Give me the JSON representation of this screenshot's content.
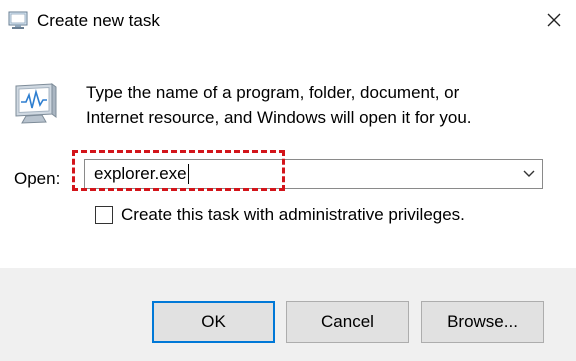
{
  "window": {
    "title": "Create new task",
    "icons": {
      "app": "run-app-icon",
      "close": "close-icon"
    }
  },
  "body": {
    "description_line1": "Type the name of a program, folder, document, or",
    "description_line2": "Internet resource, and Windows will open it for you.",
    "icon": "monitor-activity-icon"
  },
  "open": {
    "label": "Open:",
    "value": "explorer.exe",
    "dropdown_icon": "chevron-down-icon"
  },
  "admin": {
    "label": "Create this task with administrative privileges.",
    "checked": false
  },
  "buttons": {
    "ok": "OK",
    "cancel": "Cancel",
    "browse": "Browse..."
  },
  "colors": {
    "highlight": "#d3141a",
    "primary_border": "#0078d7",
    "footer_bg": "#f0f0f0"
  }
}
